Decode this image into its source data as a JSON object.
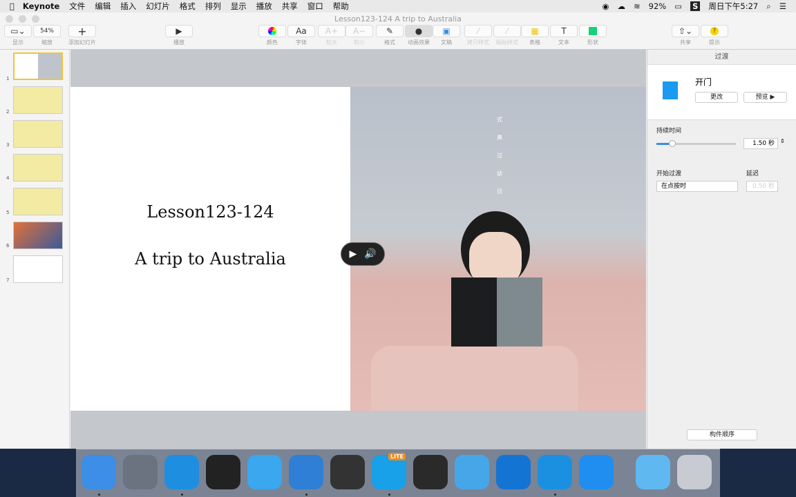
{
  "menubar": {
    "app": "Keynote",
    "items": [
      "文件",
      "编辑",
      "插入",
      "幻灯片",
      "格式",
      "排列",
      "显示",
      "播放",
      "共享",
      "窗口",
      "帮助"
    ],
    "battery": "92%",
    "clock": "周日下午5:27"
  },
  "window": {
    "title": "Lesson123-124 A trip to Australia"
  },
  "toolbar": {
    "view": "显示",
    "zoom_value": "54%",
    "zoom": "缩放",
    "add_slide": "添加幻灯片",
    "play": "播放",
    "color": "颜色",
    "font": "字体",
    "bigger": "较大",
    "smaller": "较小",
    "format": "格式",
    "animate": "动画效果",
    "document": "文稿",
    "copy_style": "拷贝样式",
    "paste_style": "粘贴样式",
    "table": "表格",
    "text": "文本",
    "shape": "形状",
    "share": "共享",
    "tips": "提示",
    "font_glyph": "Aa",
    "bigger_glyph": "A+",
    "smaller_glyph": "A−",
    "text_glyph": "T"
  },
  "slides": [
    {
      "n": "1"
    },
    {
      "n": "2"
    },
    {
      "n": "3"
    },
    {
      "n": "4"
    },
    {
      "n": "5"
    },
    {
      "n": "6"
    },
    {
      "n": "7"
    }
  ],
  "slide": {
    "title": "Lesson123-124",
    "subtitle": "A trip to Australia",
    "vertical_text": "式 弗 过 幼 日"
  },
  "inspector": {
    "header": "过渡",
    "transition_name": "开门",
    "change": "更改",
    "preview": "预览 ▶",
    "duration_label": "持续时间",
    "duration_value": "1.50 秒",
    "duration_fraction": 0.2,
    "start_label": "开始过渡",
    "start_value": "在点按时",
    "delay_label": "延迟",
    "delay_value": "0.50 秒",
    "build_order": "构件顺序"
  },
  "dock": [
    {
      "name": "Finder",
      "color": "#3c8ee6"
    },
    {
      "name": "Launchpad",
      "color": "#6b7380"
    },
    {
      "name": "Safari",
      "color": "#1e8fe0"
    },
    {
      "name": "QQ",
      "color": "#222"
    },
    {
      "name": "QQ Browser",
      "color": "#3aa7ee"
    },
    {
      "name": "Keynote",
      "color": "#2f7fd6"
    },
    {
      "name": "Video",
      "color": "#333"
    },
    {
      "name": "LITE",
      "color": "#18a0e8"
    },
    {
      "name": "QuickTime",
      "color": "#2a2a2a"
    },
    {
      "name": "Preview",
      "color": "#47a6e8"
    },
    {
      "name": "K",
      "color": "#1474d4"
    },
    {
      "name": "Cloud",
      "color": "#1c90e0"
    },
    {
      "name": "App Store",
      "color": "#1f8ef0"
    },
    {
      "name": "Folder",
      "color": "#5fb8f0"
    },
    {
      "name": "Trash",
      "color": "#c8ccd2"
    }
  ]
}
